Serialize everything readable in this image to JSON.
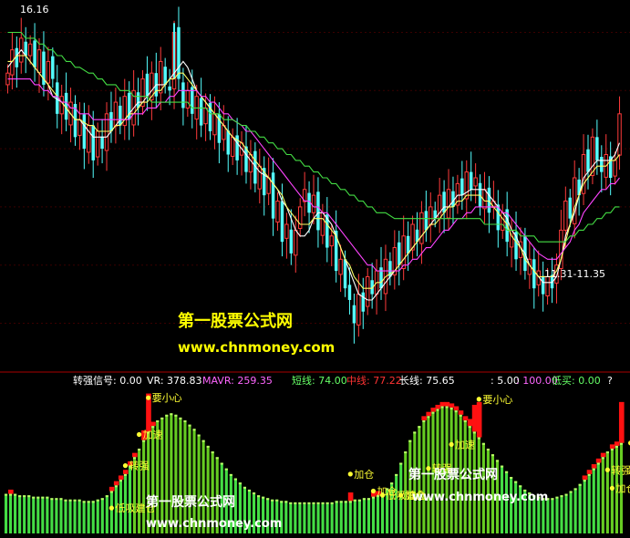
{
  "chart_data": [
    {
      "type": "candlestick",
      "panel": "price",
      "price_high_label": "16.16",
      "price_low_label": "11.31-11.35",
      "ylim": [
        10.6,
        16.4
      ],
      "colors": {
        "up": "#ff3b3b",
        "down": "#54ffff"
      },
      "ohlc_close": [
        15.3,
        15.7,
        15.4,
        15.9,
        15.6,
        15.8,
        15.4,
        15.7,
        15.1,
        15.5,
        15.2,
        14.6,
        14.9,
        14.5,
        14.8,
        14.2,
        14.5,
        14.0,
        14.4,
        13.8,
        14.3,
        14.0,
        14.6,
        14.3,
        14.8,
        14.4,
        14.9,
        14.5,
        15.0,
        14.7,
        15.2,
        14.9,
        15.3,
        14.9,
        15.5,
        15.1,
        15.0,
        16.0,
        15.2,
        14.7,
        15.0,
        14.6,
        14.9,
        14.4,
        14.7,
        14.3,
        14.6,
        14.1,
        14.4,
        13.9,
        14.2,
        13.8,
        14.1,
        13.6,
        13.9,
        13.4,
        13.7,
        13.2,
        13.5,
        12.8,
        13.1,
        12.4,
        12.7,
        12.2,
        12.6,
        13.0,
        13.3,
        12.9,
        13.2,
        12.6,
        12.9,
        12.3,
        12.5,
        11.9,
        12.1,
        11.6,
        11.4,
        11.0,
        11.5,
        11.2,
        11.8,
        11.5,
        11.9,
        11.6,
        12.1,
        11.8,
        12.3,
        12.0,
        12.5,
        12.2,
        12.7,
        12.4,
        12.9,
        12.6,
        13.0,
        12.8,
        13.2,
        12.9,
        13.3,
        13.0,
        13.4,
        13.2,
        13.6,
        13.3,
        13.5,
        13.0,
        13.3,
        12.9,
        13.1,
        12.6,
        12.9,
        12.4,
        12.6,
        12.1,
        12.4,
        11.9,
        12.1,
        11.6,
        11.9,
        11.5,
        11.8,
        11.6,
        12.0,
        12.6,
        13.1,
        12.8,
        13.5,
        13.2,
        13.9,
        13.6,
        14.2,
        13.8,
        13.6,
        13.9,
        13.5,
        13.8,
        14.6
      ],
      "ma_lines": [
        {
          "color": "#ffffff",
          "values": [
            15.4,
            15.5,
            15.6,
            15.7,
            15.6,
            15.5,
            15.4,
            15.3,
            15.2,
            15.1,
            14.9,
            14.8,
            14.7,
            14.6,
            14.5,
            14.5,
            14.4,
            14.3,
            14.2,
            14.2,
            14.2,
            14.2,
            14.3,
            14.4,
            14.5,
            14.5,
            14.6,
            14.7,
            14.8,
            14.8,
            14.9,
            15.0,
            15.1,
            15.1,
            15.2,
            15.3,
            15.4,
            15.5,
            15.4,
            15.2,
            15.0,
            14.9,
            14.8,
            14.7,
            14.6,
            14.5,
            14.4,
            14.3,
            14.2,
            14.1,
            14.0,
            13.9,
            13.8,
            13.7,
            13.6,
            13.5,
            13.4,
            13.3,
            13.1,
            13.0,
            12.8,
            12.6,
            12.5,
            12.5,
            12.6,
            12.8,
            12.9,
            12.9,
            12.8,
            12.7,
            12.5,
            12.3,
            12.1,
            11.9,
            11.7,
            11.5,
            11.4,
            11.4,
            11.5,
            11.6,
            11.7,
            11.8,
            11.9,
            12.0,
            12.1,
            12.2,
            12.3,
            12.4,
            12.5,
            12.6,
            12.7,
            12.8,
            12.9,
            13.0,
            13.0,
            13.1,
            13.2,
            13.2,
            13.3,
            13.3,
            13.3,
            13.3,
            13.2,
            13.1,
            13.0,
            12.9,
            12.8,
            12.6,
            12.5,
            12.3,
            12.2,
            12.0,
            11.9,
            11.8,
            11.7,
            11.7,
            11.7,
            11.8,
            12.1,
            12.5,
            12.9,
            13.2,
            13.5,
            13.6,
            13.7,
            13.8,
            13.8,
            13.8,
            13.8,
            13.9,
            14.1
          ]
        },
        {
          "color": "#ffff66",
          "values": [
            15.5,
            15.5,
            15.6,
            15.6,
            15.6,
            15.5,
            15.4,
            15.3,
            15.2,
            15.1,
            15.0,
            14.9,
            14.8,
            14.7,
            14.6,
            14.5,
            14.5,
            14.4,
            14.4,
            14.3,
            14.3,
            14.3,
            14.3,
            14.4,
            14.4,
            14.5,
            14.6,
            14.6,
            14.7,
            14.8,
            14.8,
            14.9,
            15.0,
            15.0,
            15.1,
            15.2,
            15.2,
            15.3,
            15.3,
            15.2,
            15.1,
            15.0,
            14.9,
            14.8,
            14.7,
            14.6,
            14.5,
            14.4,
            14.3,
            14.2,
            14.1,
            14.0,
            13.9,
            13.8,
            13.7,
            13.6,
            13.5,
            13.4,
            13.3,
            13.2,
            13.0,
            12.9,
            12.8,
            12.7,
            12.7,
            12.7,
            12.8,
            12.8,
            12.8,
            12.7,
            12.6,
            12.5,
            12.3,
            12.1,
            12.0,
            11.8,
            11.7,
            11.6,
            11.6,
            11.6,
            11.7,
            11.7,
            11.8,
            11.9,
            12.0,
            12.1,
            12.2,
            12.3,
            12.4,
            12.5,
            12.6,
            12.7,
            12.7,
            12.8,
            12.9,
            13.0,
            13.0,
            13.1,
            13.1,
            13.2,
            13.2,
            13.2,
            13.2,
            13.1,
            13.1,
            13.0,
            12.9,
            12.8,
            12.7,
            12.5,
            12.4,
            12.3,
            12.1,
            12.0,
            11.9,
            11.8,
            11.8,
            11.8,
            11.9,
            12.1,
            12.4,
            12.7,
            13.0,
            13.2,
            13.4,
            13.5,
            13.6,
            13.7,
            13.7,
            13.7,
            13.8,
            13.8,
            13.9
          ]
        },
        {
          "color": "#ff44ff",
          "values": [
            15.2,
            15.2,
            15.2,
            15.2,
            15.2,
            15.2,
            15.1,
            15.1,
            15.0,
            15.0,
            14.9,
            14.9,
            14.8,
            14.8,
            14.7,
            14.7,
            14.6,
            14.6,
            14.5,
            14.5,
            14.5,
            14.5,
            14.5,
            14.5,
            14.5,
            14.5,
            14.5,
            14.6,
            14.6,
            14.6,
            14.7,
            14.7,
            14.7,
            14.8,
            14.8,
            14.9,
            14.9,
            15.0,
            15.0,
            15.0,
            15.0,
            15.0,
            14.9,
            14.9,
            14.8,
            14.8,
            14.7,
            14.6,
            14.6,
            14.5,
            14.4,
            14.3,
            14.3,
            14.2,
            14.1,
            14.0,
            13.9,
            13.8,
            13.7,
            13.6,
            13.5,
            13.4,
            13.3,
            13.2,
            13.1,
            13.1,
            13.0,
            13.0,
            12.9,
            12.9,
            12.8,
            12.7,
            12.6,
            12.5,
            12.4,
            12.3,
            12.2,
            12.1,
            12.0,
            12.0,
            11.9,
            11.9,
            11.9,
            11.9,
            11.9,
            12.0,
            12.0,
            12.1,
            12.1,
            12.2,
            12.3,
            12.3,
            12.4,
            12.5,
            12.6,
            12.6,
            12.7,
            12.8,
            12.8,
            12.9,
            12.9,
            13.0,
            13.0,
            13.0,
            13.0,
            13.0,
            13.0,
            12.9,
            12.9,
            12.8,
            12.7,
            12.6,
            12.5,
            12.4,
            12.3,
            12.2,
            12.1,
            12.1,
            12.1,
            12.2,
            12.3,
            12.4,
            12.6,
            12.7,
            12.9,
            13.0,
            13.1,
            13.2,
            13.3,
            13.3,
            13.4,
            13.4,
            13.5
          ]
        },
        {
          "color": "#44dd44",
          "values": [
            16.0,
            16.0,
            16.0,
            16.0,
            15.9,
            15.9,
            15.9,
            15.8,
            15.8,
            15.7,
            15.7,
            15.6,
            15.6,
            15.5,
            15.5,
            15.4,
            15.4,
            15.3,
            15.3,
            15.2,
            15.2,
            15.1,
            15.1,
            15.1,
            15.0,
            15.0,
            15.0,
            14.9,
            14.9,
            14.9,
            14.9,
            14.8,
            14.8,
            14.8,
            14.8,
            14.8,
            14.8,
            14.8,
            14.8,
            14.8,
            14.7,
            14.7,
            14.7,
            14.7,
            14.6,
            14.6,
            14.6,
            14.5,
            14.5,
            14.5,
            14.4,
            14.4,
            14.3,
            14.3,
            14.2,
            14.2,
            14.1,
            14.1,
            14.0,
            14.0,
            13.9,
            13.9,
            13.8,
            13.8,
            13.7,
            13.7,
            13.6,
            13.6,
            13.5,
            13.5,
            13.4,
            13.4,
            13.3,
            13.3,
            13.2,
            13.2,
            13.1,
            13.1,
            13.0,
            13.0,
            12.9,
            12.9,
            12.9,
            12.8,
            12.8,
            12.8,
            12.8,
            12.8,
            12.8,
            12.8,
            12.8,
            12.8,
            12.8,
            12.8,
            12.8,
            12.8,
            12.8,
            12.8,
            12.8,
            12.8,
            12.8,
            12.8,
            12.8,
            12.7,
            12.7,
            12.7,
            12.7,
            12.7,
            12.6,
            12.6,
            12.6,
            12.5,
            12.5,
            12.5,
            12.5,
            12.4,
            12.4,
            12.4,
            12.4,
            12.4,
            12.4,
            12.5,
            12.5,
            12.6,
            12.6,
            12.7,
            12.7,
            12.8,
            12.8,
            12.9,
            12.9,
            13.0,
            13.0
          ]
        }
      ],
      "watermark_cn": "第一股票公式网",
      "watermark_url": "www.chnmoney.com"
    },
    {
      "type": "bar",
      "panel": "indicator",
      "ylim": [
        0,
        100
      ],
      "header": [
        {
          "label": "转强信号: 0.00",
          "color": "#ffffff"
        },
        {
          "label": "VR: 378.83",
          "color": "#ffffff"
        },
        {
          "label": "MAVR: 259.35",
          "color": "#ff66ff"
        },
        {
          "label": "短线: 74.00",
          "color": "#66ff66"
        },
        {
          "label": "中线: 77.22",
          "color": "#ff3333"
        },
        {
          "label": "长线: 75.65",
          "color": "#ffffff"
        },
        {
          "label": ": 5.00",
          "color": "#ffffff"
        },
        {
          "label": ": 100.00",
          "color": "#ff66ff"
        },
        {
          "label": "低买: 0.00",
          "color": "#66ff66"
        },
        {
          "label": "?",
          "color": "#ffffff"
        }
      ],
      "green_values": [
        28,
        28,
        28,
        27,
        27,
        27,
        26,
        26,
        26,
        26,
        25,
        25,
        25,
        24,
        24,
        24,
        24,
        23,
        23,
        23,
        24,
        25,
        27,
        30,
        34,
        38,
        42,
        48,
        54,
        60,
        66,
        72,
        76,
        80,
        82,
        84,
        85,
        84,
        82,
        80,
        77,
        74,
        70,
        66,
        62,
        58,
        54,
        50,
        46,
        42,
        39,
        36,
        33,
        31,
        29,
        27,
        26,
        25,
        24,
        24,
        23,
        23,
        22,
        22,
        22,
        22,
        22,
        22,
        22,
        22,
        22,
        22,
        23,
        23,
        23,
        23,
        24,
        24,
        25,
        25,
        26,
        27,
        29,
        32,
        36,
        42,
        50,
        58,
        66,
        72,
        76,
        80,
        83,
        86,
        88,
        90,
        90,
        89,
        87,
        84,
        80,
        76,
        72,
        68,
        64,
        60,
        56,
        52,
        48,
        44,
        40,
        37,
        34,
        31,
        29,
        27,
        26,
        25,
        25,
        25,
        26,
        27,
        28,
        30,
        32,
        35,
        38,
        42,
        46,
        50,
        54,
        58,
        60,
        62,
        64
      ],
      "red_values": [
        0,
        10,
        0,
        0,
        0,
        0,
        0,
        0,
        0,
        0,
        0,
        0,
        0,
        0,
        0,
        0,
        0,
        0,
        0,
        0,
        0,
        0,
        0,
        10,
        18,
        14,
        24,
        30,
        52,
        0,
        70,
        96,
        74,
        0,
        0,
        0,
        0,
        0,
        0,
        0,
        0,
        0,
        0,
        0,
        0,
        0,
        0,
        0,
        0,
        0,
        0,
        0,
        0,
        0,
        0,
        0,
        0,
        0,
        0,
        0,
        0,
        0,
        0,
        0,
        0,
        0,
        0,
        0,
        0,
        0,
        0,
        0,
        0,
        0,
        0,
        26,
        0,
        0,
        0,
        0,
        18,
        20,
        0,
        0,
        0,
        0,
        0,
        0,
        0,
        0,
        0,
        22,
        26,
        30,
        38,
        44,
        56,
        66,
        72,
        82,
        80,
        78,
        88,
        90,
        0,
        0,
        0,
        0,
        0,
        0,
        0,
        0,
        0,
        0,
        0,
        0,
        0,
        0,
        0,
        0,
        0,
        0,
        0,
        0,
        0,
        0,
        28,
        24,
        34,
        36,
        40,
        0,
        56,
        60,
        90
      ],
      "signals": [
        {
          "index": 23,
          "label": "低吸建仓",
          "value": 18
        },
        {
          "index": 26,
          "label": "转强",
          "value": 48
        },
        {
          "index": 29,
          "label": "加速",
          "value": 70
        },
        {
          "index": 31,
          "label": "要小心",
          "value": 96
        },
        {
          "index": 75,
          "label": "加仓",
          "value": 42
        },
        {
          "index": 80,
          "label": "加仓",
          "value": 30
        },
        {
          "index": 82,
          "label": "低吸建仓",
          "value": 27
        },
        {
          "index": 86,
          "label": "加仓",
          "value": 27
        },
        {
          "index": 92,
          "label": "转强",
          "value": 46
        },
        {
          "index": 97,
          "label": "加速",
          "value": 63
        },
        {
          "index": 103,
          "label": "要小心",
          "value": 95
        },
        {
          "index": 131,
          "label": "转强",
          "value": 45
        },
        {
          "index": 132,
          "label": "加仓",
          "value": 32
        },
        {
          "index": 136,
          "label": "加速重仓",
          "value": 64
        }
      ],
      "watermark_cn": "第一股票公式网",
      "watermark_url": "www.chnmoney.com"
    }
  ]
}
